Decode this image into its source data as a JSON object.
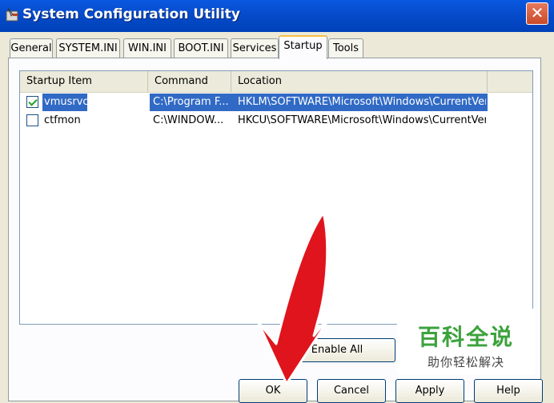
{
  "window": {
    "title": "System Configuration Utility",
    "close_glyph": "✕"
  },
  "tabs": [
    {
      "label": "General"
    },
    {
      "label": "SYSTEM.INI"
    },
    {
      "label": "WIN.INI"
    },
    {
      "label": "BOOT.INI"
    },
    {
      "label": "Services"
    },
    {
      "label": "Startup",
      "active": true
    },
    {
      "label": "Tools"
    }
  ],
  "list": {
    "columns": [
      "Startup Item",
      "Command",
      "Location"
    ],
    "rows": [
      {
        "checked": true,
        "selected": true,
        "item": "vmusrvc",
        "command": "C:\\Program F...",
        "location": "HKLM\\SOFTWARE\\Microsoft\\Windows\\CurrentVer..."
      },
      {
        "checked": false,
        "selected": false,
        "item": "ctfmon",
        "command": "C:\\WINDOW...",
        "location": "HKCU\\SOFTWARE\\Microsoft\\Windows\\CurrentVer..."
      }
    ]
  },
  "buttons": {
    "enable_all": "Enable All",
    "ok": "OK",
    "cancel": "Cancel",
    "apply": "Apply",
    "help": "Help"
  },
  "watermark": {
    "title": "百科全说",
    "subtitle": "助你轻松解决"
  },
  "colors": {
    "title_bar": "#0549c7",
    "selection": "#316ac5",
    "arrow": "#e0141c",
    "watermark_green": "#3ca23c"
  }
}
